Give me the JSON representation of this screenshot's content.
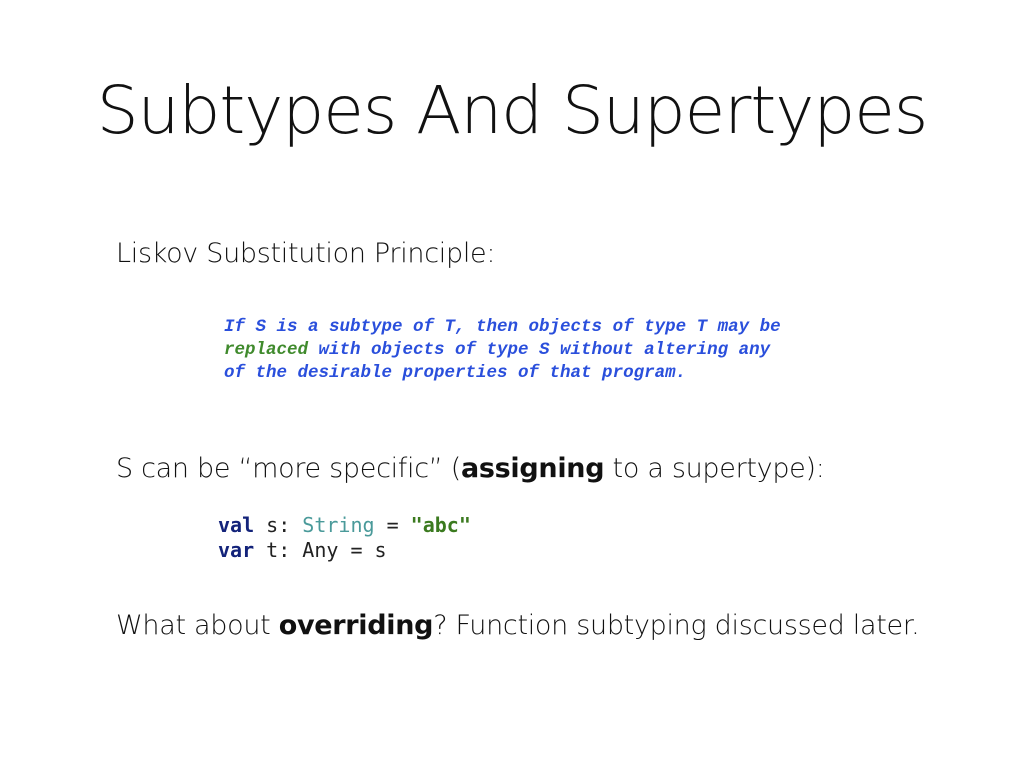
{
  "title": "Subtypes And Supertypes",
  "lsp_label": "Liskov Substitution Principle:",
  "quote": {
    "line1": "If S is a subtype of T, then objects of type T may be",
    "line2_highlight": "replaced",
    "line2_rest": " with objects of type S without altering any",
    "line3": "of the desirable properties of that program."
  },
  "specific": {
    "before": "S can be “more specific” (",
    "bold": "assigning",
    "after": " to a supertype):"
  },
  "code": {
    "line1": {
      "kw": "val",
      "name": " s: ",
      "type": "String",
      "eq": " = ",
      "str": "\"abc\""
    },
    "line2": {
      "kw": "var",
      "rest": " t: Any = s"
    }
  },
  "overriding": {
    "before": "What about ",
    "bold": "overriding",
    "after": "? Function subtyping discussed later."
  },
  "colors": {
    "quote": "#2a4fdc",
    "quote_highlight": "#3f8a2c",
    "keyword": "#13237a",
    "type": "#4a9a9a",
    "string": "#3b7a1f"
  }
}
